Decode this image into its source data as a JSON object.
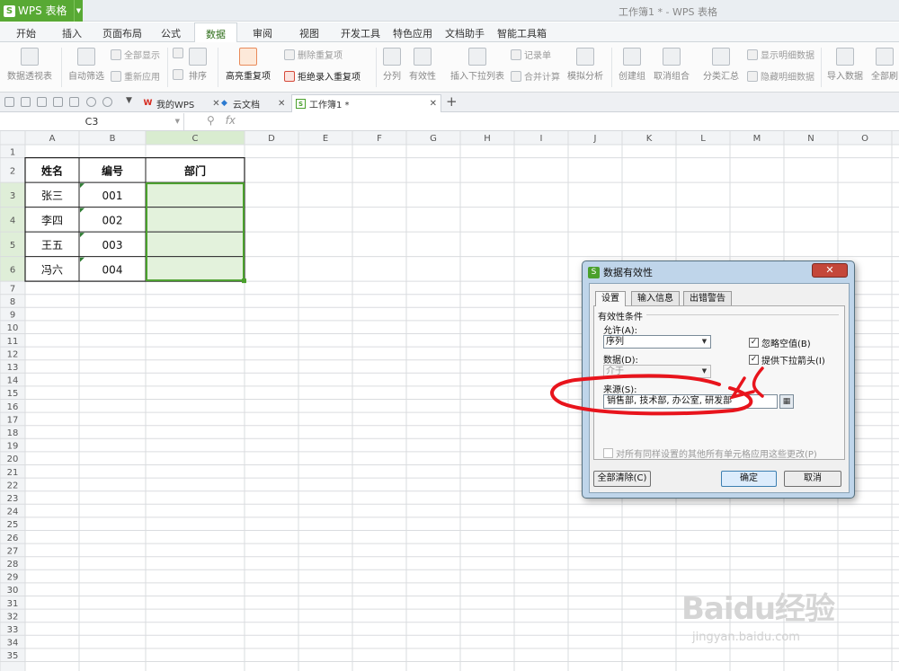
{
  "app": {
    "name": "WPS 表格",
    "window_title": "工作簿1 * - WPS 表格",
    "brand_color": "#58a934"
  },
  "menu": [
    "开始",
    "插入",
    "页面布局",
    "公式",
    "数据",
    "审阅",
    "视图",
    "开发工具",
    "特色应用",
    "文档助手",
    "智能工具箱"
  ],
  "menu_active": "数据",
  "ribbon": {
    "pivot": "数据透视表",
    "autofilter": "自动筛选",
    "show_all": "全部显示",
    "reapply": "重新应用",
    "sort": "排序",
    "highlight_dup": "高亮重复项",
    "delete_dup": "删除重复项",
    "reject_dup": "拒绝录入重复项",
    "split": "分列",
    "validity": "有效性",
    "dropdown_list": "插入下拉列表",
    "record_form": "记录单",
    "consolidate": "合并计算",
    "simulate": "模拟分析",
    "group": "创建组",
    "ungroup": "取消组合",
    "subtotal": "分类汇总",
    "show_detail": "显示明细数据",
    "hide_detail": "隐藏明细数据",
    "import": "导入数据",
    "refresh_all": "全部刷"
  },
  "tabs": [
    {
      "label": "我的WPS",
      "icon": "wps-icon"
    },
    {
      "label": "云文档",
      "icon": "cloud-icon"
    },
    {
      "label": "工作簿1 *",
      "icon": "sheet-icon"
    }
  ],
  "formula": {
    "cell_ref": "C3",
    "fx": "fx",
    "zoom_icon": "magnifier-icon"
  },
  "columns": [
    "A",
    "B",
    "C",
    "D",
    "E",
    "F",
    "G",
    "H",
    "I",
    "J",
    "K",
    "L",
    "M",
    "N",
    "O"
  ],
  "table": {
    "headers": [
      "姓名",
      "编号",
      "部门"
    ],
    "rows": [
      [
        "张三",
        "001",
        ""
      ],
      [
        "李四",
        "002",
        ""
      ],
      [
        "王五",
        "003",
        ""
      ],
      [
        "冯六",
        "004",
        ""
      ]
    ]
  },
  "dialog": {
    "title": "数据有效性",
    "close": "✕",
    "tabs": [
      "设置",
      "输入信息",
      "出错警告"
    ],
    "group_label": "有效性条件",
    "allow_label": "允许(A):",
    "allow_value": "序列",
    "data_label": "数据(D):",
    "data_value": "介于",
    "ignore_blank": "忽略空值(B)",
    "dropdown_arrow": "提供下拉箭头(I)",
    "source_label": "来源(S):",
    "source_value": "销售部, 技术部, 办公室, 研发部",
    "apply_all": "对所有同样设置的其他所有单元格应用这些更改(P)",
    "clear_all": "全部清除(C)",
    "ok": "确定",
    "cancel": "取消"
  },
  "annotation_color": "#e8141c",
  "watermark": {
    "main": "Baidu经验",
    "sub": "jingyan.baidu.com"
  }
}
